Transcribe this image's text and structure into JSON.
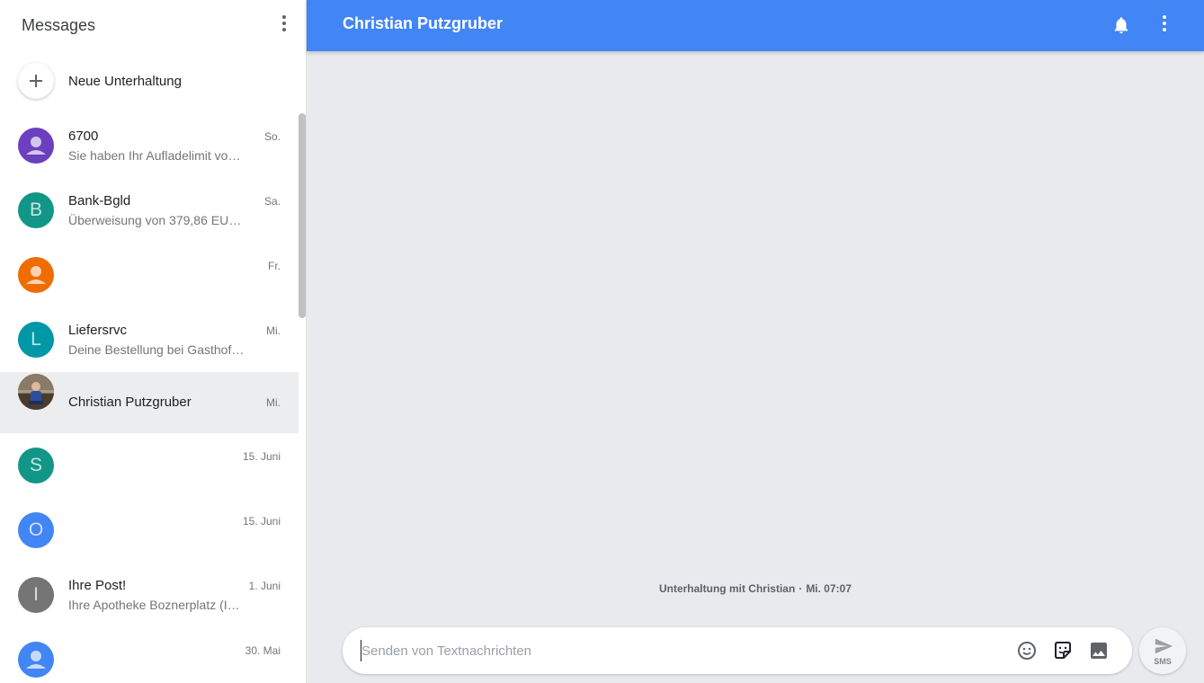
{
  "sidebar": {
    "title": "Messages",
    "new_conversation_label": "Neue Unterhaltung",
    "conversations": [
      {
        "name": "6700",
        "snippet": "Sie haben Ihr Aufladelimit vo…",
        "time": "So.",
        "avatar_letter": "",
        "avatar_color": "#6c3fc0",
        "avatar_icon": "person-icon"
      },
      {
        "name": "Bank-Bgld",
        "snippet": "Überweisung von 379,86 EU…",
        "time": "Sa.",
        "avatar_letter": "B",
        "avatar_color": "#129688",
        "avatar_icon": ""
      },
      {
        "name": "",
        "snippet": "",
        "time": "Fr.",
        "avatar_letter": "",
        "avatar_color": "#ef6c00",
        "avatar_icon": "person-icon"
      },
      {
        "name": "Liefersrvc",
        "snippet": "Deine Bestellung bei Gasthof…",
        "time": "Mi.",
        "avatar_letter": "L",
        "avatar_color": "#0097a7",
        "avatar_icon": ""
      },
      {
        "name": "Christian Putzgruber",
        "snippet": "",
        "time": "Mi.",
        "avatar_letter": "",
        "avatar_color": "#5d4037",
        "avatar_icon": "photo-avatar",
        "selected": true
      },
      {
        "name": "",
        "snippet": "",
        "time": "15. Juni",
        "avatar_letter": "S",
        "avatar_color": "#129688",
        "avatar_icon": ""
      },
      {
        "name": "",
        "snippet": "",
        "time": "15. Juni",
        "avatar_letter": "O",
        "avatar_color": "#4285f4",
        "avatar_icon": ""
      },
      {
        "name": "Ihre Post!",
        "snippet": "Ihre Apotheke Boznerplatz (I…",
        "time": "1. Juni",
        "avatar_letter": "I",
        "avatar_color": "#757575",
        "avatar_icon": ""
      },
      {
        "name": "",
        "snippet": "",
        "time": "30. Mai",
        "avatar_letter": "",
        "avatar_color": "#4285f4",
        "avatar_icon": "person-icon"
      }
    ]
  },
  "header": {
    "title": "Christian Putzgruber",
    "accent_color": "#4285f4"
  },
  "conversation": {
    "meta_label": "Unterhaltung mit Christian",
    "meta_time": "Mi. 07:07",
    "meta_separator": "·"
  },
  "compose": {
    "placeholder": "Senden von Textnachrichten",
    "send_label": "SMS"
  }
}
